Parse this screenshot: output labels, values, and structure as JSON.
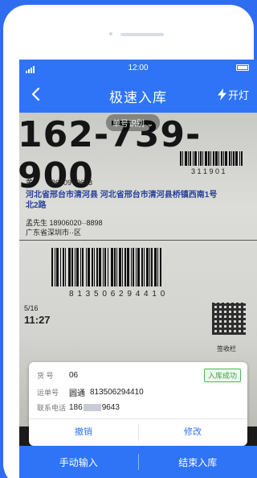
{
  "status_bar": {
    "time": "12:00"
  },
  "nav": {
    "title": "极速入库",
    "torch_label": "开灯"
  },
  "camera": {
    "big_number": "162-739-900",
    "hint": "单号识别 ⌄",
    "barcode_top_digits": "3 1 1 9 0 1",
    "label_lines": {
      "line1": "黄    186309··9643",
      "line2": "河北省邢台市清河县  河北省邢台市清河县桥镇西南1号",
      "line3": "北2路",
      "line4": "孟先生  18906020··8898",
      "line5": "广东省深圳市··区",
      "barcode_digits": "8 1 3 5 0 6 2 9 4 4 1 0",
      "date": "5/16",
      "time": "11:27",
      "sign_label": "签收栏"
    }
  },
  "card": {
    "shelf_key": "货  号",
    "shelf_value": "06",
    "status": "入库成功",
    "waybill_key": "运单号",
    "courier": "圆通",
    "waybill_value": "813506294410",
    "phone_key": "联系电话",
    "phone_prefix": "186",
    "phone_suffix": "9643",
    "cancel_label": "撤销",
    "edit_label": "修改"
  },
  "bottom": {
    "manual_label": "手动输入",
    "finish_label": "结束入库"
  },
  "colors": {
    "primary": "#2f74f6",
    "success": "#3b9f48",
    "background": "#2f6df0"
  },
  "icons": {
    "back": "chevron-left-icon",
    "torch": "flash-icon",
    "signal": "signal-icon",
    "battery": "battery-icon"
  }
}
